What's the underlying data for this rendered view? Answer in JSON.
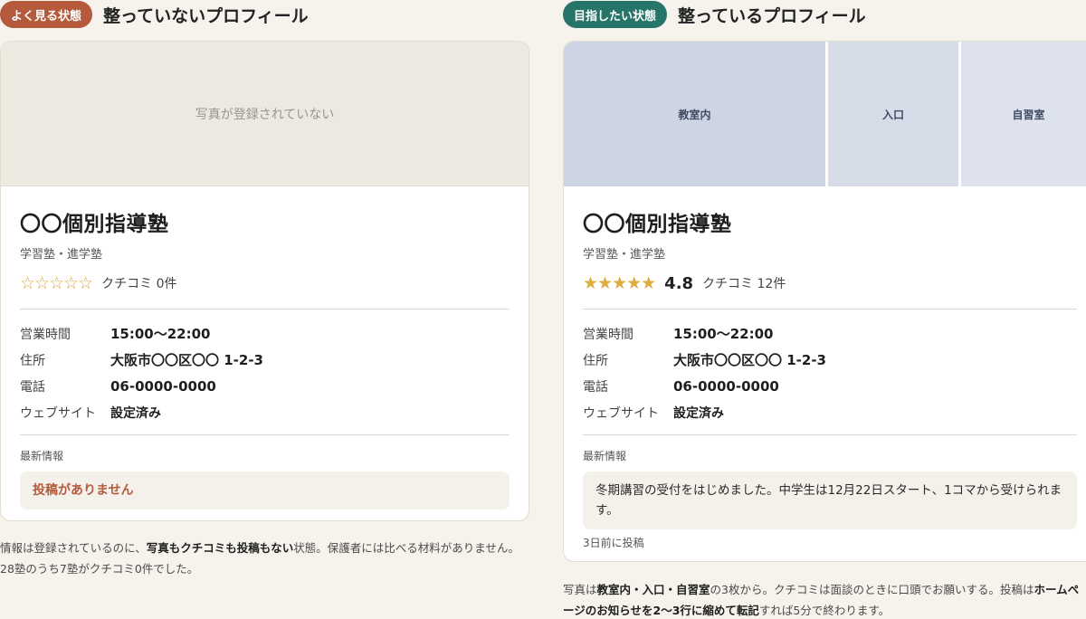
{
  "left": {
    "badge": "よく見る状態",
    "title": "整っていないプロフィール",
    "photo_placeholder": "写真が登録されていない",
    "name": "〇〇個別指導塾",
    "category": "学習塾・進学塾",
    "stars": "☆☆☆☆☆",
    "rating_value": 0,
    "reviews": "クチコミ 0件",
    "info": [
      {
        "key": "営業時間",
        "value": "15:00〜22:00"
      },
      {
        "key": "住所",
        "value": "大阪市〇〇区〇〇 1-2-3"
      },
      {
        "key": "電話",
        "value": "06-0000-0000"
      },
      {
        "key": "ウェブサイト",
        "value": "設定済み"
      }
    ],
    "news_label": "最新情報",
    "news_text": "投稿がありません",
    "caption": {
      "p1": "情報は登録されているのに、",
      "b1": "写真もクチコミも投稿もない",
      "p2": "状態。保護者には比べる材料がありません。28塾のうち7塾がクチコミ0件でした。"
    }
  },
  "right": {
    "badge": "目指したい状態",
    "title": "整っているプロフィール",
    "photos": [
      "教室内",
      "入口",
      "自習室"
    ],
    "name": "〇〇個別指導塾",
    "category": "学習塾・進学塾",
    "stars": "★★★★★",
    "score": "4.8",
    "reviews": "クチコミ 12件",
    "info": [
      {
        "key": "営業時間",
        "value": "15:00〜22:00"
      },
      {
        "key": "住所",
        "value": "大阪市〇〇区〇〇 1-2-3"
      },
      {
        "key": "電話",
        "value": "06-0000-0000"
      },
      {
        "key": "ウェブサイト",
        "value": "設定済み"
      }
    ],
    "news_label": "最新情報",
    "news_text": "冬期講習の受付をはじめました。中学生は12月22日スタート、1コマから受けられます。",
    "news_date": "3日前に投稿",
    "caption": {
      "p1": "写真は",
      "b1": "教室内・入口・自習室",
      "p2": "の3枚から。クチコミは面談のときに口頭でお願いする。投稿は",
      "b2": "ホームページのお知らせを2〜3行に縮めて転記",
      "p3": "すれば5分で終わります。"
    }
  },
  "colors": {
    "bad_badge": "#b55a3c",
    "good_badge": "#27756a",
    "star": "#e0ad3a",
    "background": "#f6f3ec"
  }
}
